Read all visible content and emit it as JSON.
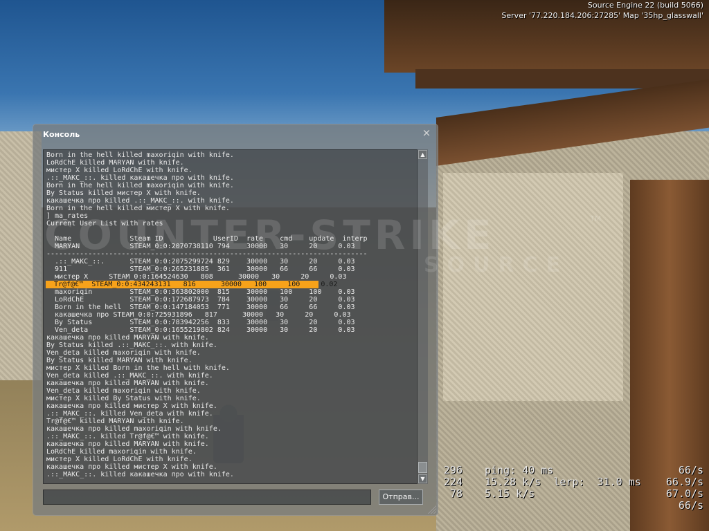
{
  "server_info": {
    "engine": "Source Engine 22 (build 5066)",
    "server": "Server '77.220.184.206:27285' Map '35hp_glasswall'"
  },
  "logo": {
    "main": "COUNTER-STRIKE",
    "sub": "SOURCE",
    "tm": "TM"
  },
  "console": {
    "title": "Консоль",
    "close_glyph": "×",
    "submit_label": "Отправ...",
    "input_value": "",
    "lines": [
      "Born in the hell killed maxoriqin with knife.",
      "LoRdChE killed MARYAN with knife.",
      "мистер X killed LoRdChE with knife.",
      ".::_MAKC_::. killed какашечка про with knife.",
      "Born in the hell killed maxoriqin with knife.",
      "By Status killed мистер X with knife.",
      "какашечка про killed .::_MAKC_::. with knife.",
      "Born in the hell killed мистер X with knife.",
      "] ma_rates",
      "Current User List with rates",
      "",
      "  Name              Steam ID            UserID  rate    cmd    update  interp",
      "  MARYAN            STEAM_0:0:2070738110 794    30000   30     20     0.03",
      "-----------------------------------------------------------------------------",
      "  .::_MAKC_::.      STEAM_0:0:2075299724 829    30000   30     20     0.03",
      "  911               STEAM_0:0:265231885  361    30000   66     66     0.03",
      "  мистер X     STEAM_0:0:164524630   808      30000   30     20     0.03",
      "  Tr@f@€™  STEAM_0:0:434243131   816      30000   100     100     0.02",
      "  maxoriqin         STEAM_0:0:363802000  815    30000   100    100    0.03",
      "  LoRdChE           STEAM_0:0:172687973  784    30000   30     20     0.03",
      "  Born in the hell  STEAM_0:0:147184053  771    30000   66     66     0.03",
      "  какашечка про STEAM_0:0:725931896   817      30000   30     20     0.03",
      "  By Status         STEAM_0:0:783942256  833    30000   30     20     0.03",
      "  Ven_deta          STEAM_0:0:1655219802 824    30000   30     20     0.03",
      "какашечка про killed MARYAN with knife.",
      "By Status killed .::_MAKC_::. with knife.",
      "Ven_deta killed maxoriqin with knife.",
      "By Status killed MARYAN with knife.",
      "мистер X killed Born in the hell with knife.",
      "Ven_deta killed .::_MAKC_::. with knife.",
      "какашечка про killed MARYAN with knife.",
      "Ven_deta killed maxoriqin with knife.",
      "мистер X killed By Status with knife.",
      "какашечка про killed мистер X with knife.",
      ".::_MAKC_::. killed Ven_deta with knife.",
      "Tr@f@€™ killed MARYAN with knife.",
      "какашечка про killed maxoriqin with knife.",
      ".::_MAKC_::. killed Tr@f@€™ with knife.",
      "какашечка про killed MARYAN with knife.",
      "LoRdChE killed maxoriqin with knife.",
      "мистер X killed LoRdChE with knife.",
      "какашечка про killed мистер X with knife.",
      ".::_MAKC_::. killed какашечка про with knife."
    ],
    "highlighted_index": 17,
    "highlight_color": "#f7a21a"
  },
  "netgraph": {
    "rows": [
      {
        "c1": "296",
        "c2": "ping: 40 ms",
        "c3": "66/s"
      },
      {
        "c1": "224",
        "c2": "15.28 k/s  lerp:  31.0 ms",
        "c3": "66.9/s"
      },
      {
        "c1": "78",
        "c2": "5.15 k/s",
        "c3": "67.0/s"
      },
      {
        "c1": "",
        "c2": "",
        "c3": "66/s"
      }
    ]
  }
}
